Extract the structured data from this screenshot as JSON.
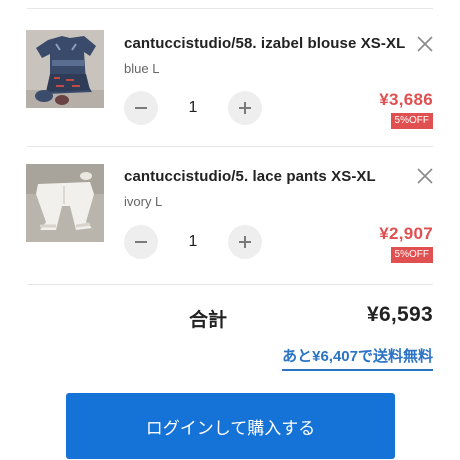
{
  "cart": {
    "items": [
      {
        "title": "cantuccistudio/58. izabel blouse XS-XL",
        "variant": "blue L",
        "quantity": "1",
        "price": "¥3,686",
        "discount": "5%OFF",
        "thumbnail_icon": "blouse-photo"
      },
      {
        "title": "cantuccistudio/5. lace pants XS-XL",
        "variant": "ivory L",
        "quantity": "1",
        "price": "¥2,907",
        "discount": "5%OFF",
        "thumbnail_icon": "pants-photo"
      }
    ],
    "icons": {
      "remove": "close-icon",
      "decrease": "minus-icon",
      "increase": "plus-icon"
    }
  },
  "summary": {
    "total_label": "合計",
    "total_value": "¥6,593",
    "free_shipping_text": "あと¥6,407で送料無料"
  },
  "actions": {
    "login_checkout_label": "ログインして購入する"
  },
  "colors": {
    "price_red": "#e15050",
    "link_blue": "#2b74c4",
    "button_blue": "#1572d6",
    "qty_button_gray": "#eeeeee"
  }
}
